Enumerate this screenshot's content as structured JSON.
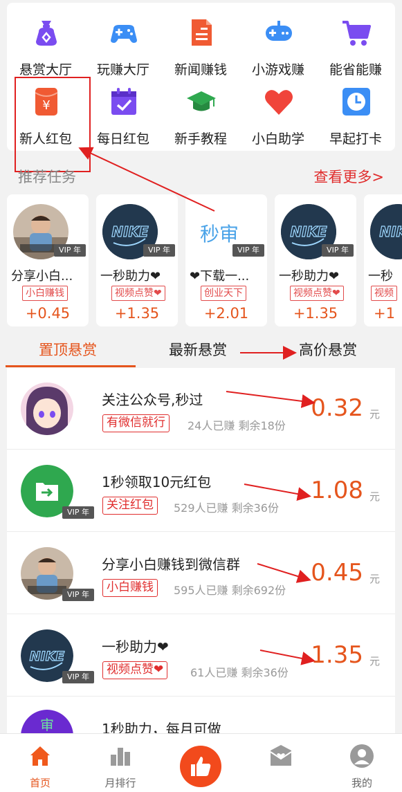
{
  "grid": {
    "row1": [
      {
        "label": "悬赏大厅",
        "icon": "money-bag-icon",
        "color": "#7a4cf0"
      },
      {
        "label": "玩赚大厅",
        "icon": "gamepad-icon",
        "color": "#3b8ef5"
      },
      {
        "label": "新闻赚钱",
        "icon": "news-document-icon",
        "color": "#f05a33"
      },
      {
        "label": "小游戏赚",
        "icon": "controller-icon",
        "color": "#3b8ef5"
      },
      {
        "label": "能省能赚",
        "icon": "shopping-cart-icon",
        "color": "#7a4cf0"
      }
    ],
    "row2": [
      {
        "label": "新人红包",
        "icon": "red-envelope-icon",
        "color": "#f05a33"
      },
      {
        "label": "每日红包",
        "icon": "calendar-check-icon",
        "color": "#7a4cf0"
      },
      {
        "label": "新手教程",
        "icon": "graduation-cap-icon",
        "color": "#2fa84f"
      },
      {
        "label": "小白助学",
        "icon": "heart-icon",
        "color": "#f0443a"
      },
      {
        "label": "早起打卡",
        "icon": "clock-icon",
        "color": "#3b8ef5"
      }
    ]
  },
  "recommended": {
    "title": "推荐任务",
    "more": "查看更多>",
    "cards": [
      {
        "title": "分享小白...",
        "tag": "小白赚钱",
        "reward": "+0.45",
        "vip": "VIP 年",
        "avatar": "photo"
      },
      {
        "title": "一秒助力❤",
        "tag": "视频点赞❤",
        "reward": "+1.35",
        "vip": "VIP 年",
        "avatar": "nike"
      },
      {
        "title": "❤下载一...",
        "tag": "创业天下",
        "reward": "+2.01",
        "vip": "VIP 年",
        "avatar": "miaoshen",
        "avatar_text": "秒审"
      },
      {
        "title": "一秒助力❤",
        "tag": "视频点赞❤",
        "reward": "+1.35",
        "vip": "VIP 年",
        "avatar": "nike"
      },
      {
        "title": "一秒",
        "tag": "视频",
        "reward": "+1",
        "vip": "",
        "avatar": "nike"
      }
    ]
  },
  "tabs": [
    {
      "label": "置顶悬赏",
      "active": true
    },
    {
      "label": "最新悬赏",
      "active": false
    },
    {
      "label": "高价悬赏",
      "active": false
    }
  ],
  "tasks": [
    {
      "title": "关注公众号,秒过",
      "tag": "有微信就行",
      "stats": "24人已赚  剩余18份",
      "price": "0.32",
      "unit": "元",
      "vip": "",
      "avatar": "anime"
    },
    {
      "title": "1秒领取10元红包",
      "tag": "关注红包",
      "stats": "529人已赚  剩余36份",
      "price": "1.08",
      "unit": "元",
      "vip": "VIP 年",
      "avatar": "folder"
    },
    {
      "title": "分享小白赚钱到微信群",
      "tag": "小白赚钱",
      "stats": "595人已赚  剩余692份",
      "price": "0.45",
      "unit": "元",
      "vip": "VIP 年",
      "avatar": "photo"
    },
    {
      "title": "一秒助力❤",
      "tag": "视频点赞❤",
      "stats": "61人已赚  剩余36份",
      "price": "1.35",
      "unit": "元",
      "vip": "VIP 年",
      "avatar": "nike"
    },
    {
      "title": "1秒助力，每月可做",
      "tag": "",
      "stats": "",
      "price": "",
      "unit": "",
      "vip": "",
      "avatar": "purple",
      "avatar_text": "审"
    }
  ],
  "nav": [
    {
      "label": "首页",
      "icon": "home-icon",
      "active": true
    },
    {
      "label": "月排行",
      "icon": "ranking-icon",
      "active": false
    },
    {
      "label": "",
      "icon": "thumbs-up-icon",
      "active": false
    },
    {
      "label": "",
      "icon": "mail-icon",
      "active": false
    },
    {
      "label": "我的",
      "icon": "user-icon",
      "active": false
    }
  ],
  "colors": {
    "accent": "#e5551d",
    "tag_red": "#e02d2d",
    "annotation_red": "#e02020"
  }
}
